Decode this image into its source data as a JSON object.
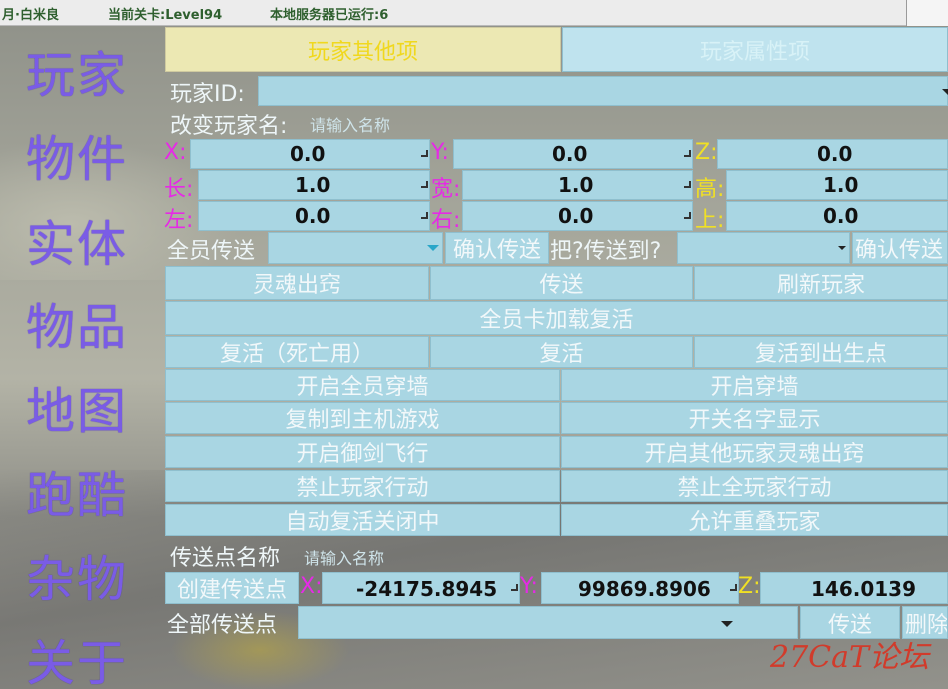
{
  "status_bar": {
    "user": "月·白米良",
    "level": "当前关卡:Level94",
    "server": "本地服务器已运行:6"
  },
  "sidebar": {
    "items": [
      "玩家",
      "物件",
      "实体",
      "物品",
      "地图",
      "跑酷",
      "杂物",
      "关于"
    ]
  },
  "tabs": {
    "other": "玩家其他项",
    "attributes": "玩家属性项"
  },
  "player": {
    "id_label": "玩家ID:",
    "rename_label": "改变玩家名:",
    "rename_placeholder": "请输入名称"
  },
  "coords": {
    "x_label": "X:",
    "y_label": "Y:",
    "z_label": "Z:",
    "x": "0.0",
    "y": "0.0",
    "z": "0.0",
    "length_label": "长:",
    "width_label": "宽:",
    "height_label": "高:",
    "length": "1.0",
    "width": "1.0",
    "height": "1.0",
    "left_label": "左:",
    "right_label": "右:",
    "up_label": "上:",
    "left": "0.0",
    "right": "0.0",
    "up": "0.0"
  },
  "teleport": {
    "all_label": "全员传送",
    "confirm": "确认传送",
    "send_label": "把?传送到?",
    "confirm2": "确认传送"
  },
  "buttons": {
    "soul_out": "灵魂出窍",
    "teleport": "传送",
    "refresh": "刷新玩家",
    "all_revive": "全员卡加载复活",
    "revive_dead": "复活（死亡用）",
    "revive": "复活",
    "revive_spawn": "复活到出生点",
    "all_noclip": "开启全员穿墙",
    "noclip": "开启穿墙",
    "copy_host": "复制到主机游戏",
    "toggle_names": "开关名字显示",
    "sword_fly": "开启御剑飞行",
    "others_soul": "开启其他玩家灵魂出窍",
    "ban_player": "禁止玩家行动",
    "ban_all": "禁止全玩家行动",
    "auto_revive": "自动复活关闭中",
    "allow_overlap": "允许重叠玩家"
  },
  "waypoint": {
    "name_label": "传送点名称",
    "name_placeholder": "请输入名称",
    "create": "创建传送点",
    "x_label": "X:",
    "y_label": "Y:",
    "z_label": "Z:",
    "x": "-24175.8945",
    "y": "99869.8906",
    "z": "146.0139",
    "all_label": "全部传送点",
    "teleport": "传送",
    "delete": "删除"
  },
  "watermark": "27CaT论坛",
  "colors": {
    "nav": "#7a5ce6",
    "panel": "#a9d6e3",
    "tab_active_text": "#f0d81e",
    "x_label": "#e62ae6",
    "y_label": "#e62ae6",
    "z_label": "#f0e024"
  }
}
